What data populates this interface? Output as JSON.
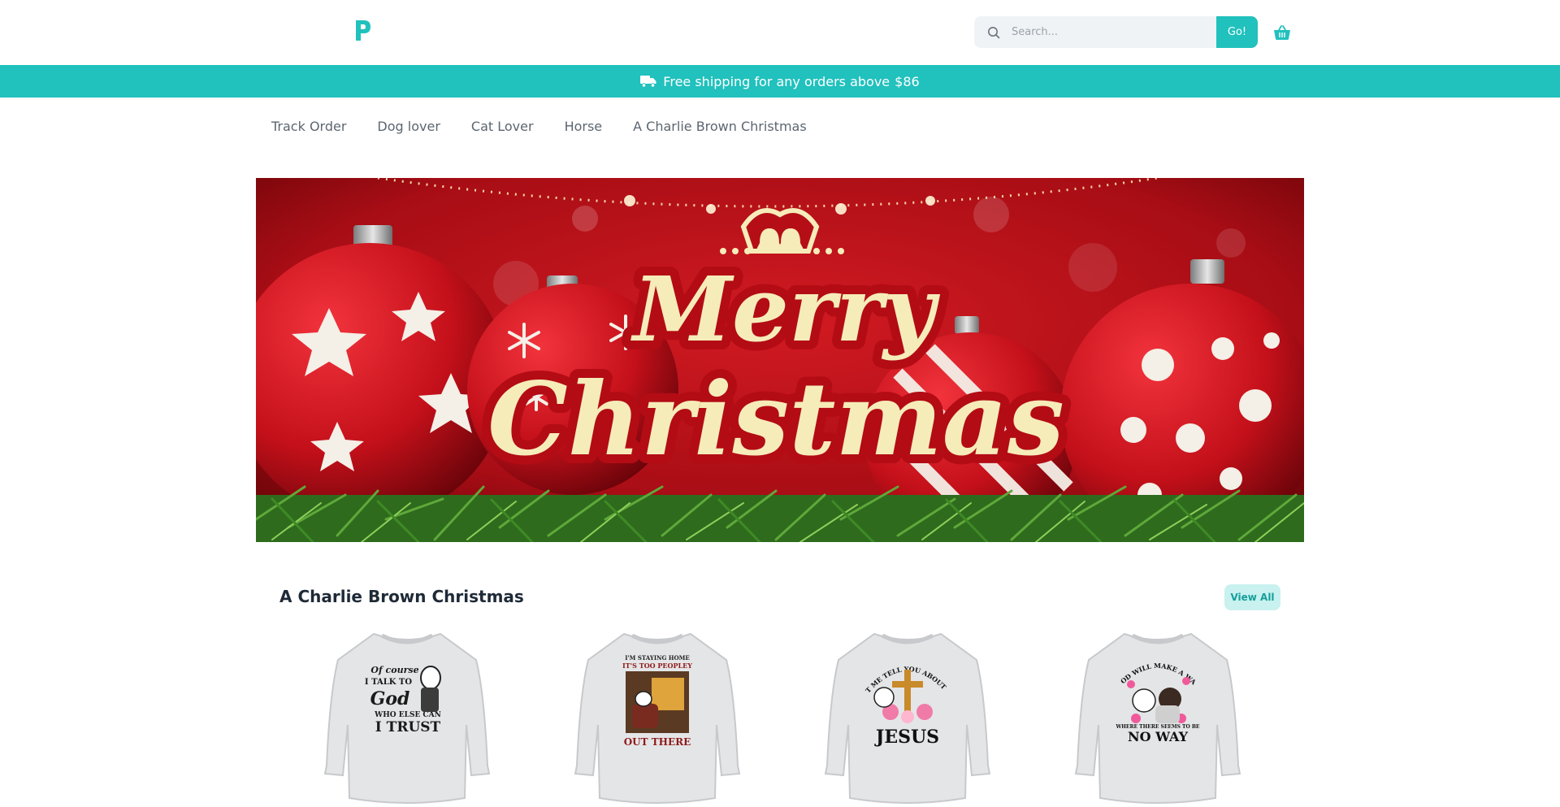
{
  "header": {
    "logo_letter": "P",
    "search": {
      "placeholder": "Search...",
      "button_label": "Go!"
    }
  },
  "promo": {
    "text": "Free shipping for any orders above",
    "amount": "$86"
  },
  "nav": {
    "items": [
      {
        "label": "Track Order"
      },
      {
        "label": "Dog lover"
      },
      {
        "label": "Cat Lover"
      },
      {
        "label": "Horse"
      },
      {
        "label": "A Charlie Brown Christmas"
      }
    ]
  },
  "hero": {
    "line1": "Merry",
    "line2": "Christmas"
  },
  "section": {
    "title": "A Charlie Brown Christmas",
    "view_all_label": "View All"
  },
  "products": [
    {
      "print_lines": [
        "Of course",
        "I TALK TO",
        "God",
        "WHO ELSE CAN",
        "I TRUST"
      ]
    },
    {
      "print_lines": [
        "I'M STAYING HOME",
        "IT'S TOO PEOPLEY",
        "OUT THERE"
      ]
    },
    {
      "print_lines": [
        "LET ME TELL YOU ABOUT MY",
        "JESUS"
      ]
    },
    {
      "print_lines": [
        "GOD WILL MAKE A WAY",
        "WHERE THERE SEEMS TO BE",
        "NO WAY"
      ]
    }
  ],
  "colors": {
    "accent": "#21c1bd",
    "hero_red": "#c0121c",
    "hero_text": "#f6ecb9"
  }
}
